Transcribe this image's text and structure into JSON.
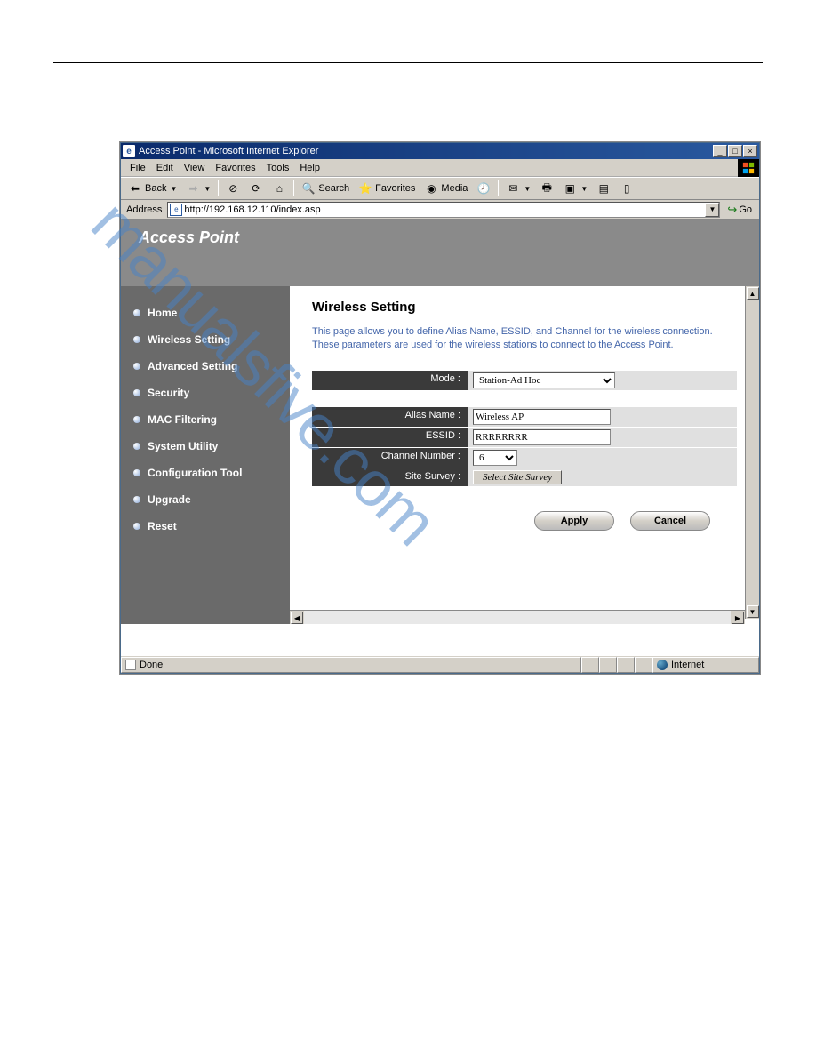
{
  "window": {
    "title": "Access Point - Microsoft Internet Explorer"
  },
  "menubar": {
    "file": "File",
    "edit": "Edit",
    "view": "View",
    "favorites": "Favorites",
    "tools": "Tools",
    "help": "Help"
  },
  "toolbar": {
    "back": "Back",
    "search": "Search",
    "favorites": "Favorites",
    "media": "Media"
  },
  "address": {
    "label": "Address",
    "value": "http://192.168.12.110/index.asp",
    "go": "Go"
  },
  "banner": {
    "title": "Access Point"
  },
  "sidebar": {
    "items": [
      {
        "label": "Home"
      },
      {
        "label": "Wireless Setting"
      },
      {
        "label": "Advanced Setting"
      },
      {
        "label": "Security"
      },
      {
        "label": "MAC Filtering"
      },
      {
        "label": "System Utility"
      },
      {
        "label": "Configuration Tool"
      },
      {
        "label": "Upgrade"
      },
      {
        "label": "Reset"
      }
    ]
  },
  "content": {
    "heading": "Wireless Setting",
    "description": "This page allows you to define Alias Name, ESSID, and Channel for the wireless connection. These parameters are used for the wireless stations to connect to the Access Point.",
    "fields": {
      "mode_label": "Mode :",
      "mode_value": "Station-Ad Hoc",
      "alias_label": "Alias Name :",
      "alias_value": "Wireless AP",
      "essid_label": "ESSID :",
      "essid_value": "RRRRRRRR",
      "channel_label": "Channel Number :",
      "channel_value": "6",
      "survey_label": "Site Survey :",
      "survey_button": "Select Site Survey"
    },
    "buttons": {
      "apply": "Apply",
      "cancel": "Cancel"
    }
  },
  "statusbar": {
    "status": "Done",
    "zone": "Internet"
  },
  "watermark": "manualsfive.com"
}
